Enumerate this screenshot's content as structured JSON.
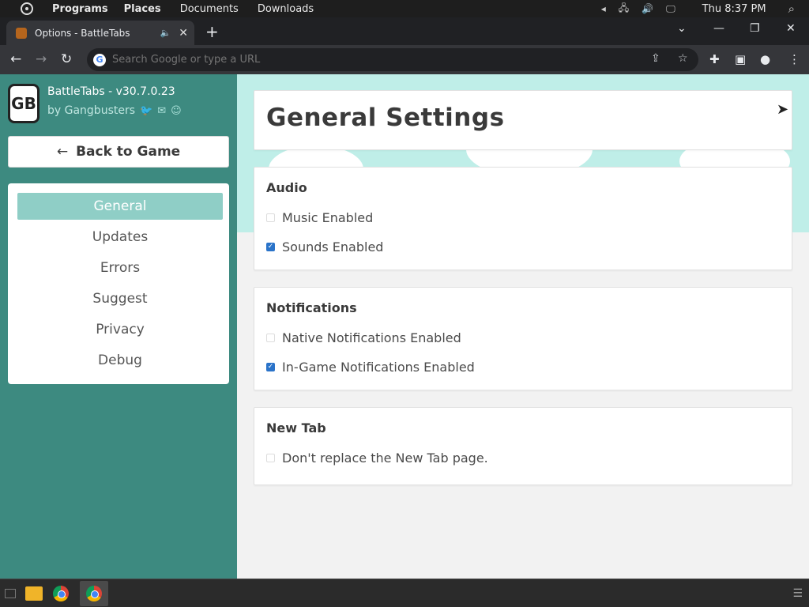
{
  "system_bar": {
    "menus": [
      "Programs",
      "Places",
      "Documents",
      "Downloads"
    ],
    "clock": "Thu 8:37 PM"
  },
  "browser": {
    "tab_title": "Options - BattleTabs",
    "omnibox_placeholder": "Search Google or type a URL"
  },
  "sidebar": {
    "app_name": "BattleTabs - v30.7.0.23",
    "by_line": "by Gangbusters",
    "logo_text": "GB",
    "back_button": "Back to Game",
    "nav_items": [
      {
        "label": "General",
        "active": true
      },
      {
        "label": "Updates",
        "active": false
      },
      {
        "label": "Errors",
        "active": false
      },
      {
        "label": "Suggest",
        "active": false
      },
      {
        "label": "Privacy",
        "active": false
      },
      {
        "label": "Debug",
        "active": false
      }
    ]
  },
  "main": {
    "page_title": "General Settings",
    "sections": [
      {
        "title": "Audio",
        "options": [
          {
            "label": "Music Enabled",
            "checked": false
          },
          {
            "label": "Sounds Enabled",
            "checked": true
          }
        ]
      },
      {
        "title": "Notifications",
        "options": [
          {
            "label": "Native Notifications Enabled",
            "checked": false
          },
          {
            "label": "In-Game Notifications Enabled",
            "checked": true
          }
        ]
      },
      {
        "title": "New Tab",
        "options": [
          {
            "label": "Don't replace the New Tab page.",
            "checked": false
          }
        ]
      }
    ]
  },
  "colors": {
    "sidebar_bg": "#3d8a80",
    "nav_active_bg": "#8fcec6",
    "checkbox_on": "#2a73c9"
  }
}
